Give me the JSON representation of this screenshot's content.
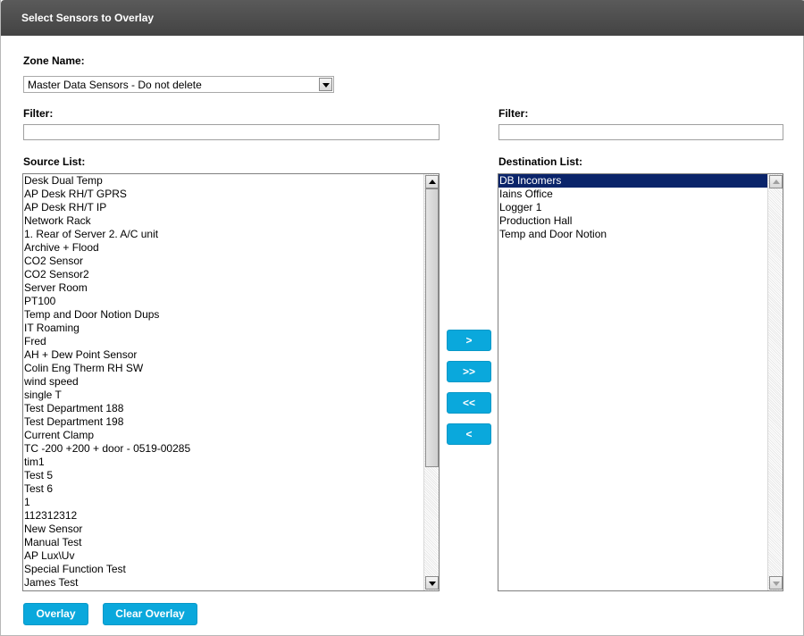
{
  "dialog": {
    "title": "Select Sensors to Overlay"
  },
  "zone": {
    "label": "Zone Name:",
    "selected": "Master Data Sensors - Do not delete"
  },
  "source": {
    "filter_label": "Filter:",
    "filter_value": "",
    "list_label": "Source List:",
    "items": [
      "Desk Dual Temp",
      "AP Desk RH/T GPRS",
      "AP Desk RH/T IP",
      "Network Rack",
      "1. Rear of Server 2. A/C unit",
      "Archive + Flood",
      "CO2 Sensor",
      "CO2 Sensor2",
      "Server Room",
      "PT100",
      "Temp and Door Notion Dups",
      "IT Roaming",
      "Fred",
      "AH + Dew Point Sensor",
      "Colin Eng Therm RH SW",
      "wind speed",
      "single T",
      "Test Department 188",
      "Test Department 198",
      "Current Clamp",
      "TC -200 +200 + door - 0519-00285",
      "tim1",
      "Test 5",
      "Test 6",
      "1",
      "112312312",
      "New Sensor",
      "Manual Test",
      "AP Lux\\Uv",
      "Special Function Test",
      "James Test"
    ]
  },
  "destination": {
    "filter_label": "Filter:",
    "filter_value": "",
    "list_label": "Destination List:",
    "items": [
      "DB Incomers",
      "Iains Office",
      "Logger 1",
      "Production Hall",
      "Temp and Door Notion"
    ],
    "selected_index": 0
  },
  "move_buttons": {
    "add_one": ">",
    "add_all": ">>",
    "remove_all": "<<",
    "remove_one": "<"
  },
  "actions": {
    "overlay": "Overlay",
    "clear_overlay": "Clear Overlay"
  },
  "colors": {
    "title_bar": "#4d4d4d",
    "button": "#0aa8dc",
    "selection": "#0a246a"
  }
}
